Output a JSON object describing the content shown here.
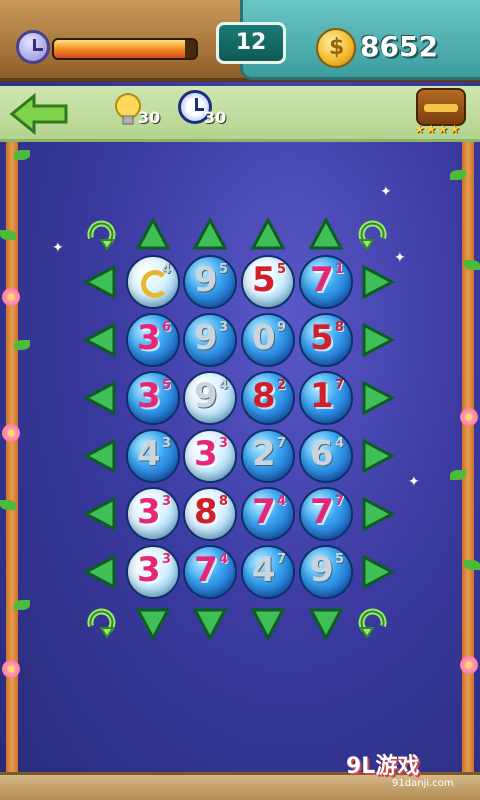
{
  "hud": {
    "time_fraction": 0.92,
    "level": "12",
    "coins": "8652",
    "hint_count": "30",
    "time_bonus_count": "30",
    "stars": "★★★★"
  },
  "colors": {
    "pink": "#e52778",
    "red": "#d31d2a",
    "silver": "#c9d4dc"
  },
  "board": {
    "rows": [
      [
        {
          "n": "",
          "s": "4",
          "color": "silver",
          "style": "light",
          "swirl": true
        },
        {
          "n": "9",
          "s": "5",
          "color": "silver",
          "style": "blue"
        },
        {
          "n": "5",
          "s": "5",
          "color": "red",
          "style": "light"
        },
        {
          "n": "7",
          "s": "1",
          "color": "pink",
          "style": "blue"
        }
      ],
      [
        {
          "n": "3",
          "s": "6",
          "color": "pink",
          "style": "blue"
        },
        {
          "n": "9",
          "s": "3",
          "color": "silver",
          "style": "blue"
        },
        {
          "n": "0",
          "s": "9",
          "color": "silver",
          "style": "blue"
        },
        {
          "n": "5",
          "s": "8",
          "color": "red",
          "style": "blue"
        }
      ],
      [
        {
          "n": "3",
          "s": "5",
          "color": "pink",
          "style": "blue"
        },
        {
          "n": "9",
          "s": "4",
          "color": "silver",
          "style": "light"
        },
        {
          "n": "8",
          "s": "2",
          "color": "red",
          "style": "blue"
        },
        {
          "n": "1",
          "s": "7",
          "color": "red",
          "style": "blue"
        }
      ],
      [
        {
          "n": "4",
          "s": "3",
          "color": "silver",
          "style": "blue"
        },
        {
          "n": "3",
          "s": "3",
          "color": "pink",
          "style": "light"
        },
        {
          "n": "2",
          "s": "7",
          "color": "silver",
          "style": "blue"
        },
        {
          "n": "6",
          "s": "4",
          "color": "silver",
          "style": "blue"
        }
      ],
      [
        {
          "n": "3",
          "s": "3",
          "color": "pink",
          "style": "light"
        },
        {
          "n": "8",
          "s": "8",
          "color": "red",
          "style": "light"
        },
        {
          "n": "7",
          "s": "4",
          "color": "pink",
          "style": "blue"
        },
        {
          "n": "7",
          "s": "7",
          "color": "pink",
          "style": "blue"
        }
      ],
      [
        {
          "n": "3",
          "s": "3",
          "color": "pink",
          "style": "light"
        },
        {
          "n": "7",
          "s": "4",
          "color": "pink",
          "style": "blue"
        },
        {
          "n": "4",
          "s": "7",
          "color": "silver",
          "style": "blue"
        },
        {
          "n": "9",
          "s": "5",
          "color": "silver",
          "style": "blue"
        }
      ]
    ]
  },
  "watermark": {
    "brand": "9L游戏",
    "site": "91danji.com"
  }
}
